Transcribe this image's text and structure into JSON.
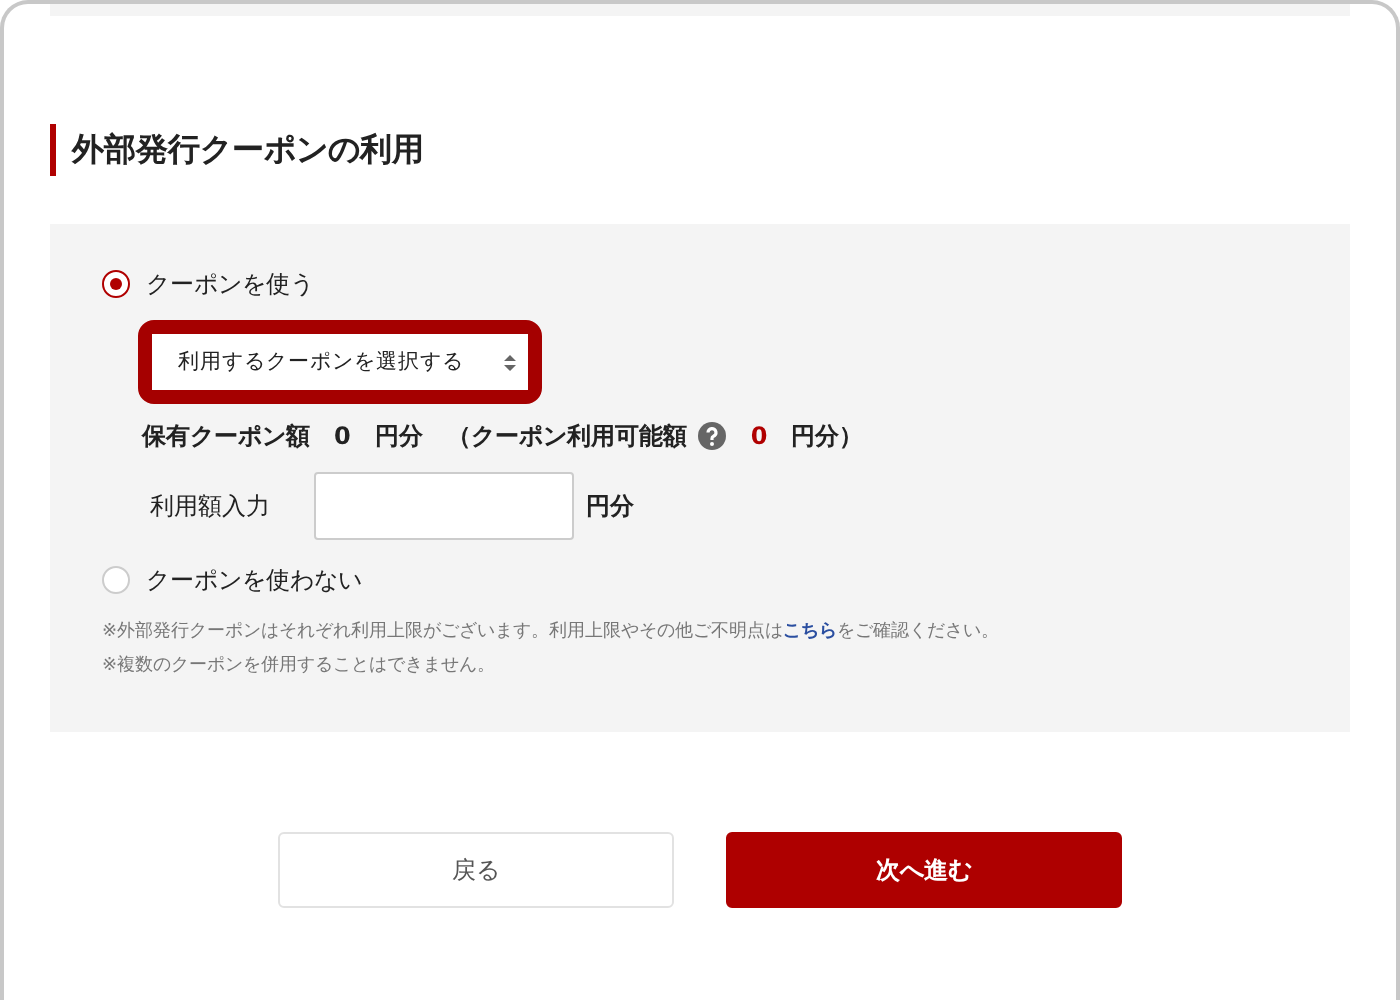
{
  "section_title": "外部発行クーポンの利用",
  "options": [
    {
      "label": "クーポンを使う",
      "selected": true
    },
    {
      "label": "クーポンを使わない",
      "selected": false
    }
  ],
  "coupon_select": {
    "value": "利用するクーポンを選択する",
    "highlighted": true
  },
  "balance": {
    "label": "保有クーポン額",
    "value": "0",
    "unit": "円分",
    "available_label": "（クーポン利用可能額",
    "available_value": "0",
    "available_unit": "円分）"
  },
  "amount": {
    "label": "利用額入力",
    "unit": "円分"
  },
  "notes": [
    {
      "before": "※外部発行クーポンはそれぞれ利用上限がございます。利用上限やその他ご不明点は",
      "link": "こちら",
      "after": "をご確認ください。"
    },
    {
      "before": "※複数のクーポンを併用することはできません。"
    }
  ],
  "buttons": [
    {
      "label": "戻る",
      "kind": "secondary"
    },
    {
      "label": "次へ進む",
      "kind": "primary"
    }
  ]
}
